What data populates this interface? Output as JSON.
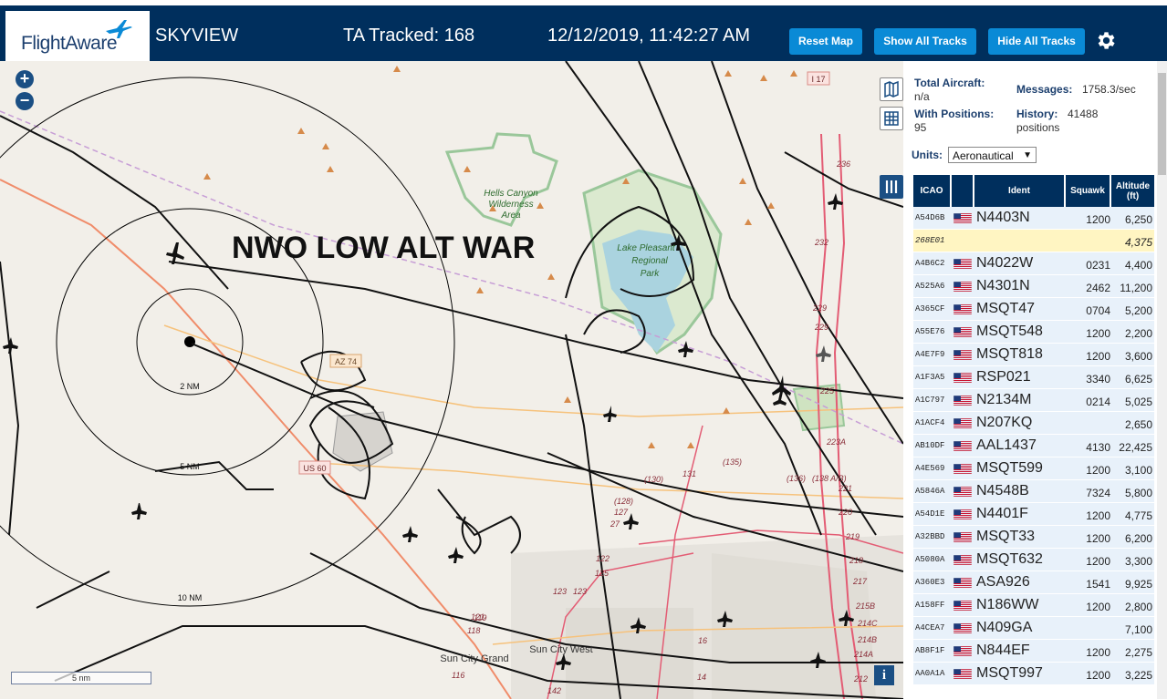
{
  "header": {
    "logo_text": "FlightAware",
    "title": "SKYVIEW",
    "tracked": "TA Tracked: 168",
    "datetime": "12/12/2019, 11:42:27 AM",
    "buttons": {
      "reset": "Reset Map",
      "show": "Show All Tracks",
      "hide": "Hide All Tracks"
    }
  },
  "map": {
    "overlay_title": "NWO LOW ALT WAR",
    "area_label_1": "Hells Canyon",
    "area_label_2": "Wilderness",
    "area_label_3": "Area",
    "lake_label_1": "Lake Pleasant",
    "lake_label_2": "Regional",
    "lake_label_3": "Park",
    "ring_labels": [
      "2 NM",
      "5 NM",
      "10 NM"
    ],
    "road_labels": [
      "AZ 74",
      "US 60",
      "I 17"
    ],
    "place_labels": [
      "Sun City Grand",
      "Sun City West"
    ],
    "route_numbers": [
      "236",
      "232",
      "229",
      "229",
      "225",
      "223A",
      "221",
      "220",
      "219",
      "218",
      "217",
      "215B",
      "214C",
      "214B",
      "214A",
      "212",
      "(130)",
      "(135)",
      "131",
      "(136)",
      "(138 A/B)",
      "(128)",
      "127",
      "27",
      "123",
      "122",
      "125",
      "123",
      "121",
      "119",
      "118",
      "116",
      "142",
      "14",
      "16"
    ],
    "scale_label": "5 nm",
    "zoom_in": "+",
    "zoom_out": "−",
    "info": "i"
  },
  "panel": {
    "total_aircraft_label": "Total Aircraft:",
    "total_aircraft_value": "n/a",
    "with_positions_label": "With Positions:",
    "with_positions_value": "95",
    "messages_label": "Messages:",
    "messages_value": "1758.3/sec",
    "history_label": "History:",
    "history_value_1": "41488",
    "history_value_2": "positions",
    "units_label": "Units:",
    "units_value": "Aeronautical",
    "columns": [
      "ICAO",
      "Ident",
      "Squawk",
      "Altitude (ft)"
    ],
    "rows": [
      {
        "icao": "A54D6B",
        "flag": true,
        "ident": "N4403N",
        "squawk": "1200",
        "alt": "6,250",
        "highlight": false
      },
      {
        "icao": "268E01",
        "flag": false,
        "ident": "",
        "squawk": "",
        "alt": "4,375",
        "highlight": true
      },
      {
        "icao": "A4B6C2",
        "flag": true,
        "ident": "N4022W",
        "squawk": "0231",
        "alt": "4,400",
        "highlight": false
      },
      {
        "icao": "A525A6",
        "flag": true,
        "ident": "N4301N",
        "squawk": "2462",
        "alt": "11,200",
        "highlight": false
      },
      {
        "icao": "A365CF",
        "flag": true,
        "ident": "MSQT47",
        "squawk": "0704",
        "alt": "5,200",
        "highlight": false
      },
      {
        "icao": "A55E76",
        "flag": true,
        "ident": "MSQT548",
        "squawk": "1200",
        "alt": "2,200",
        "highlight": false
      },
      {
        "icao": "A4E7F9",
        "flag": true,
        "ident": "MSQT818",
        "squawk": "1200",
        "alt": "3,600",
        "highlight": false
      },
      {
        "icao": "A1F3A5",
        "flag": true,
        "ident": "RSP021",
        "squawk": "3340",
        "alt": "6,625",
        "highlight": false
      },
      {
        "icao": "A1C797",
        "flag": true,
        "ident": "N2134M",
        "squawk": "0214",
        "alt": "5,025",
        "highlight": false
      },
      {
        "icao": "A1ACF4",
        "flag": true,
        "ident": "N207KQ",
        "squawk": "",
        "alt": "2,650",
        "highlight": false
      },
      {
        "icao": "AB10DF",
        "flag": true,
        "ident": "AAL1437",
        "squawk": "4130",
        "alt": "22,425",
        "highlight": false
      },
      {
        "icao": "A4E569",
        "flag": true,
        "ident": "MSQT599",
        "squawk": "1200",
        "alt": "3,100",
        "highlight": false
      },
      {
        "icao": "A5846A",
        "flag": true,
        "ident": "N4548B",
        "squawk": "7324",
        "alt": "5,800",
        "highlight": false
      },
      {
        "icao": "A54D1E",
        "flag": true,
        "ident": "N4401F",
        "squawk": "1200",
        "alt": "4,775",
        "highlight": false
      },
      {
        "icao": "A32BBD",
        "flag": true,
        "ident": "MSQT33",
        "squawk": "1200",
        "alt": "6,200",
        "highlight": false
      },
      {
        "icao": "A5080A",
        "flag": true,
        "ident": "MSQT632",
        "squawk": "1200",
        "alt": "3,300",
        "highlight": false
      },
      {
        "icao": "A360E3",
        "flag": true,
        "ident": "ASA926",
        "squawk": "1541",
        "alt": "9,925",
        "highlight": false
      },
      {
        "icao": "A158FF",
        "flag": true,
        "ident": "N186WW",
        "squawk": "1200",
        "alt": "2,800",
        "highlight": false
      },
      {
        "icao": "A4CEA7",
        "flag": true,
        "ident": "N409GA",
        "squawk": "",
        "alt": "7,100",
        "highlight": false
      },
      {
        "icao": "AB8F1F",
        "flag": true,
        "ident": "N844EF",
        "squawk": "1200",
        "alt": "2,275",
        "highlight": false
      },
      {
        "icao": "AA0A1A",
        "flag": true,
        "ident": "MSQT997",
        "squawk": "1200",
        "alt": "3,225",
        "highlight": false
      }
    ]
  },
  "colors": {
    "header_bg": "#002f5d",
    "button": "#0a8ad6",
    "row_bg": "#e8f1fa",
    "row_highlight": "#fff5c2",
    "table_header": "#002f5d"
  }
}
